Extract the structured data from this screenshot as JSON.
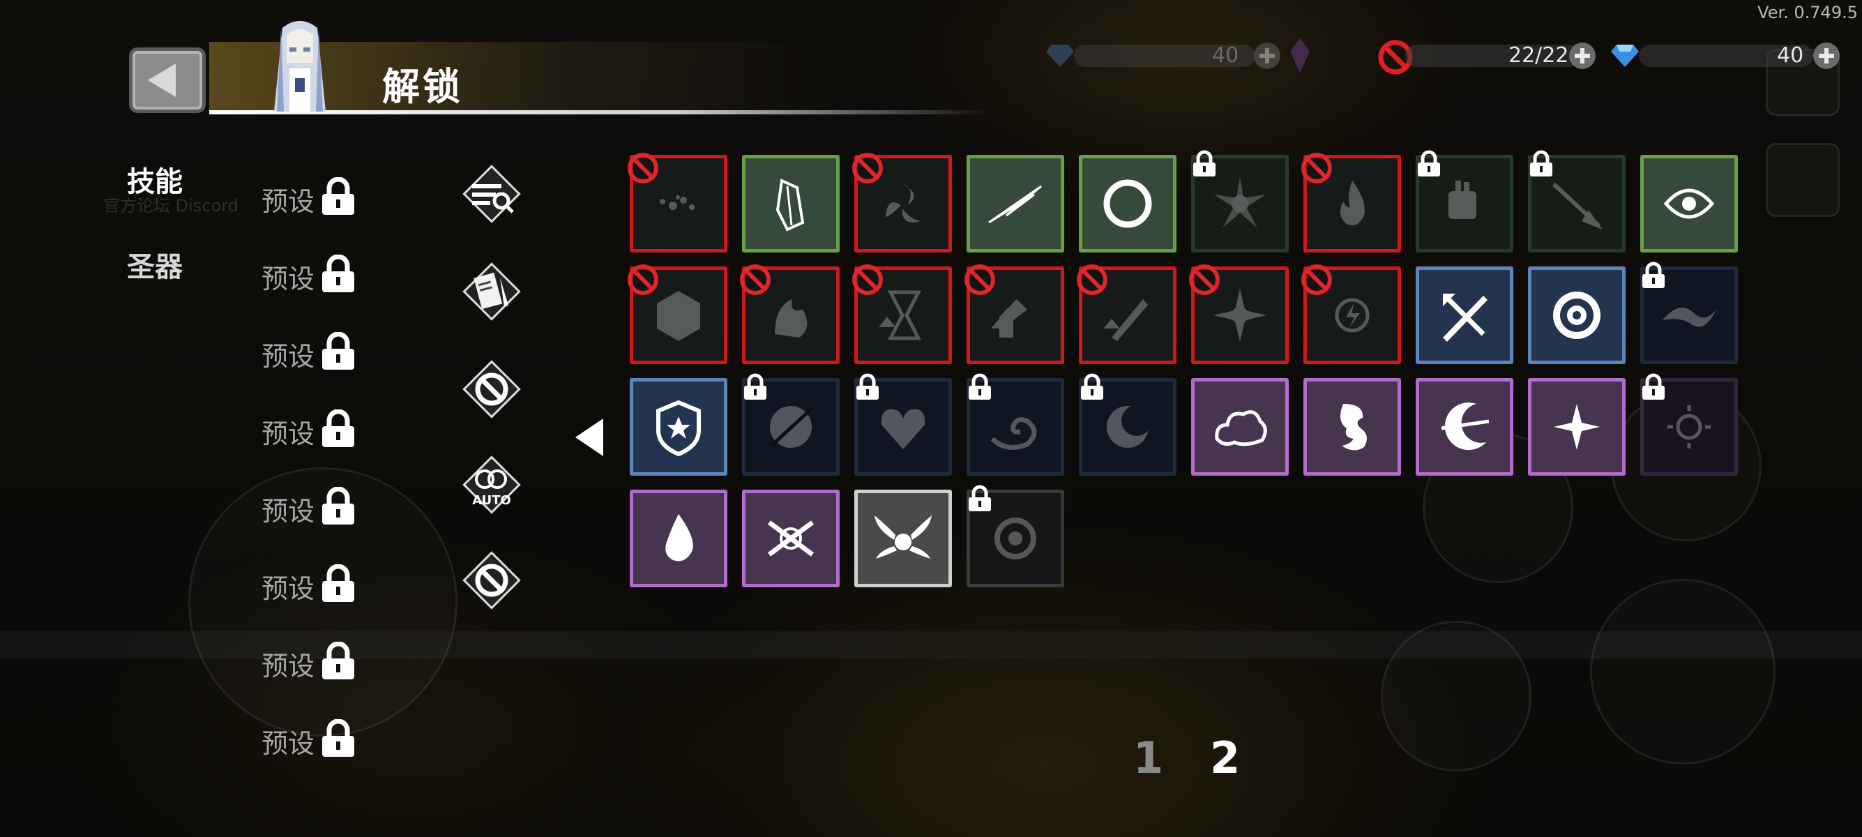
{
  "version": "Ver. 0.749.5",
  "page_title": "解锁",
  "currencies": {
    "ghost_gem_value": "40",
    "ticket_value": "22/22",
    "gem_value": "40"
  },
  "categories": [
    "技能",
    "圣器"
  ],
  "presets": [
    "预设",
    "预设",
    "预设",
    "预设",
    "预设",
    "预设",
    "预设",
    "预设"
  ],
  "filters": [
    "filter-search-icon",
    "filter-scroll-icon",
    "filter-ban-icon",
    "filter-auto-icon",
    "filter-ban-alt-icon"
  ],
  "filter_auto_label": "AUTO",
  "pagination": {
    "pages": [
      "1",
      "2"
    ],
    "current": "2"
  },
  "colors": {
    "red_frame": "#d01818",
    "green_frame": "#67a142",
    "blue_frame": "#5b84b9",
    "purple_frame": "#b26ccf",
    "white_frame": "#cfcfcf"
  },
  "skills": [
    {
      "row": 0,
      "col": 0,
      "frame": "red",
      "state": "banned",
      "icon": "dust-icon"
    },
    {
      "row": 0,
      "col": 1,
      "frame": "green",
      "state": "available",
      "icon": "crystal-shard-icon"
    },
    {
      "row": 0,
      "col": 2,
      "frame": "red",
      "state": "banned",
      "icon": "triple-blade-icon"
    },
    {
      "row": 0,
      "col": 3,
      "frame": "green",
      "state": "available",
      "icon": "slash-icon"
    },
    {
      "row": 0,
      "col": 4,
      "frame": "green",
      "state": "available",
      "icon": "ring-icon"
    },
    {
      "row": 0,
      "col": 5,
      "frame": "dgreen",
      "state": "locked",
      "icon": "burst-icon"
    },
    {
      "row": 0,
      "col": 6,
      "frame": "red",
      "state": "banned",
      "icon": "flame-icon"
    },
    {
      "row": 0,
      "col": 7,
      "frame": "dgreen",
      "state": "locked",
      "icon": "gauntlet-icon"
    },
    {
      "row": 0,
      "col": 8,
      "frame": "dgreen",
      "state": "locked",
      "icon": "spear-icon"
    },
    {
      "row": 0,
      "col": 9,
      "frame": "green",
      "state": "available",
      "icon": "vortex-eye-icon"
    },
    {
      "row": 1,
      "col": 0,
      "frame": "red",
      "state": "banned",
      "icon": "hex-shield-icon"
    },
    {
      "row": 1,
      "col": 1,
      "frame": "red",
      "state": "banned",
      "icon": "fire-spirit-icon"
    },
    {
      "row": 1,
      "col": 2,
      "frame": "red",
      "state": "banned",
      "icon": "hourglass-icon"
    },
    {
      "row": 1,
      "col": 3,
      "frame": "red",
      "state": "banned",
      "icon": "power-up-icon"
    },
    {
      "row": 1,
      "col": 4,
      "frame": "red",
      "state": "banned",
      "icon": "sword-up-icon"
    },
    {
      "row": 1,
      "col": 5,
      "frame": "red",
      "state": "banned",
      "icon": "spin-blade-icon"
    },
    {
      "row": 1,
      "col": 6,
      "frame": "red",
      "state": "banned",
      "icon": "lightning-orb-icon"
    },
    {
      "row": 1,
      "col": 7,
      "frame": "blue",
      "state": "available",
      "icon": "crossed-weapons-icon"
    },
    {
      "row": 1,
      "col": 8,
      "frame": "blue",
      "state": "available",
      "icon": "rose-icon"
    },
    {
      "row": 1,
      "col": 9,
      "frame": "dblue",
      "state": "locked",
      "icon": "wave-icon"
    },
    {
      "row": 2,
      "col": 0,
      "frame": "blue",
      "state": "available",
      "icon": "shield-star-icon"
    },
    {
      "row": 2,
      "col": 1,
      "frame": "dblue",
      "state": "locked",
      "icon": "sphere-slash-icon"
    },
    {
      "row": 2,
      "col": 2,
      "frame": "dblue",
      "state": "locked",
      "icon": "heart-wing-icon"
    },
    {
      "row": 2,
      "col": 3,
      "frame": "dblue",
      "state": "locked",
      "icon": "swirl-icon"
    },
    {
      "row": 2,
      "col": 4,
      "frame": "dblue",
      "state": "locked",
      "icon": "moon-orb-icon"
    },
    {
      "row": 2,
      "col": 5,
      "frame": "purple",
      "state": "available",
      "icon": "cloud-icon"
    },
    {
      "row": 2,
      "col": 6,
      "frame": "purple",
      "state": "available",
      "icon": "dragon-icon"
    },
    {
      "row": 2,
      "col": 7,
      "frame": "purple",
      "state": "available",
      "icon": "crescent-icon"
    },
    {
      "row": 2,
      "col": 8,
      "frame": "purple",
      "state": "available",
      "icon": "shuriken-icon"
    },
    {
      "row": 2,
      "col": 9,
      "frame": "dpurple",
      "state": "locked",
      "icon": "sun-moon-icon"
    },
    {
      "row": 3,
      "col": 0,
      "frame": "purple",
      "state": "available",
      "icon": "drop-icon"
    },
    {
      "row": 3,
      "col": 1,
      "frame": "purple",
      "state": "available",
      "icon": "cross-slash-icon"
    },
    {
      "row": 3,
      "col": 2,
      "frame": "white",
      "state": "available",
      "icon": "winged-orb-icon"
    },
    {
      "row": 3,
      "col": 3,
      "frame": "gray",
      "state": "locked",
      "icon": "gear-icon"
    }
  ]
}
